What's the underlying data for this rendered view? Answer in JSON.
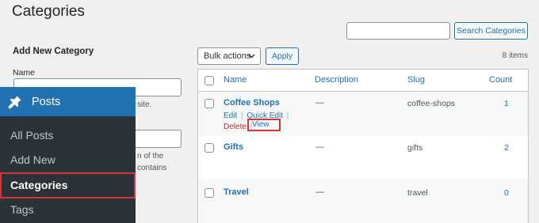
{
  "page": {
    "title": "Categories"
  },
  "form": {
    "heading": "Add New Category",
    "name_label": "Name",
    "name_hint": "site.",
    "slug_hint_line1": "n of the",
    "slug_hint_line2": "contains"
  },
  "admin_menu": {
    "posts_label": "Posts",
    "items": [
      "All Posts",
      "Add New",
      "Categories",
      "Tags"
    ],
    "current": "Categories"
  },
  "search": {
    "button_label": "Search Categories",
    "value": ""
  },
  "bulk": {
    "selected": "Bulk actions",
    "apply_label": "Apply"
  },
  "items_count": "8 items",
  "table": {
    "headers": {
      "name": "Name",
      "description": "Description",
      "slug": "Slug",
      "count": "Count"
    },
    "rows": [
      {
        "name": "Coffee Shops",
        "description": "—",
        "slug": "coffee-shops",
        "count": "1"
      },
      {
        "name": "Gifts",
        "description": "—",
        "slug": "gifts",
        "count": "2"
      },
      {
        "name": "Travel",
        "description": "—",
        "slug": "travel",
        "count": "0"
      }
    ],
    "row_actions": {
      "edit": "Edit",
      "quick_edit": "Quick Edit",
      "delete": "Delete",
      "view": "View",
      "sep": "|"
    }
  },
  "colors": {
    "accent": "#2271b1",
    "highlight": "#d63638",
    "menu_bg": "#1d2327",
    "submenu_bg": "#2c3338"
  }
}
